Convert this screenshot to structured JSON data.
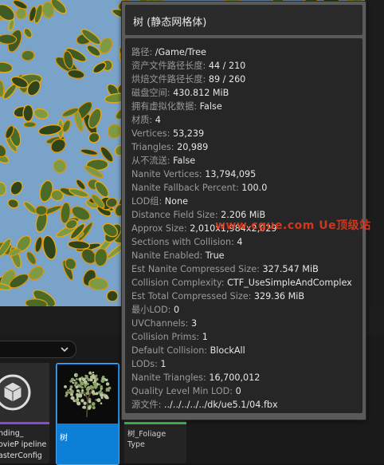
{
  "tooltip": {
    "title": "树 (静态网格体)",
    "rows": [
      {
        "key": "路径: ",
        "value": "/Game/Tree"
      },
      {
        "key": "资产文件路径长度: ",
        "value": "44 / 210"
      },
      {
        "key": "烘焙文件路径长度: ",
        "value": "89 / 260"
      },
      {
        "key": "磁盘空间: ",
        "value": "430.812 MiB"
      },
      {
        "key": "拥有虚拟化数据: ",
        "value": "False"
      },
      {
        "key": "材质: ",
        "value": "4"
      },
      {
        "key": "Vertices: ",
        "value": "53,239"
      },
      {
        "key": "Triangles: ",
        "value": "20,989"
      },
      {
        "key": "从不流送: ",
        "value": "False"
      },
      {
        "key": "Nanite Vertices: ",
        "value": "13,794,095"
      },
      {
        "key": "Nanite Fallback Percent: ",
        "value": "100.0"
      },
      {
        "key": "LOD组: ",
        "value": "None"
      },
      {
        "key": "Distance Field Size: ",
        "value": "2.206 MiB"
      },
      {
        "key": "Approx Size: ",
        "value": "2,010x1,984x2,029"
      },
      {
        "key": "Sections with Collision: ",
        "value": "4"
      },
      {
        "key": "Nanite Enabled: ",
        "value": "True"
      },
      {
        "key": "Est Nanite Compressed Size: ",
        "value": "327.547 MiB"
      },
      {
        "key": "Collision Complexity: ",
        "value": "CTF_UseSimpleAndComplex"
      },
      {
        "key": "Est Total Compressed Size: ",
        "value": "329.36 MiB"
      },
      {
        "key": "最小LOD: ",
        "value": "0"
      },
      {
        "key": "UVChannels: ",
        "value": "3"
      },
      {
        "key": "Collision Prims: ",
        "value": "1"
      },
      {
        "key": "Default Collision: ",
        "value": "BlockAll"
      },
      {
        "key": "LODs: ",
        "value": "1"
      },
      {
        "key": "Nanite Triangles: ",
        "value": "16,700,012"
      },
      {
        "key": "Quality Level Min LOD: ",
        "value": "0"
      },
      {
        "key": "源文件: ",
        "value": "../../../../../dk/ue5.1/04.fbx"
      }
    ]
  },
  "watermark": "www.cgue.com Ue顶级站",
  "assets": {
    "mrq_label": "nding_\novieP ipeline\nasterConfig",
    "tree_label": "树",
    "foliage_label": "树_Foliage\nType"
  },
  "colors": {
    "tree_selected": "#0e7fd6",
    "mrq_accent": "#8a47d8",
    "foliage_accent": "#3db64b"
  }
}
